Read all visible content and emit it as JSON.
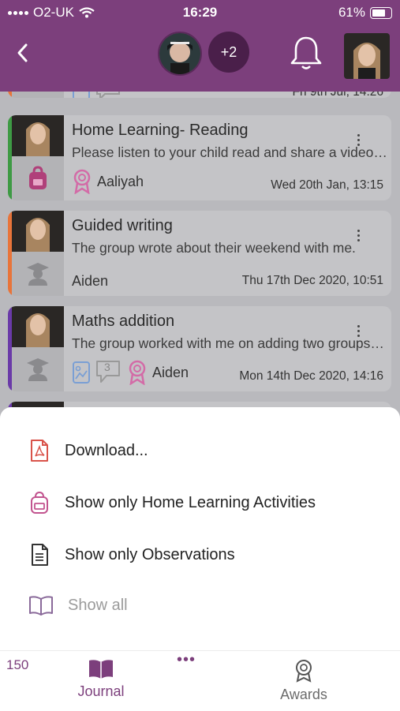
{
  "status_bar": {
    "carrier": "O2-UK",
    "time": "16:29",
    "battery": "61%"
  },
  "header": {
    "more_children": "+2"
  },
  "entries": [
    {
      "title": "",
      "description": "",
      "date": "Fri 9th Jul, 14:26",
      "bar_color": "#e8743a"
    },
    {
      "title": "Home Learning- Reading",
      "description": "Please listen to your child read and share a video of them reading.",
      "award_name": "Aaliyah",
      "date": "Wed 20th Jan, 13:15",
      "bar_color": "#3e9a44"
    },
    {
      "title": "Guided writing",
      "description": "The group wrote about their weekend with me.",
      "child_name": "Aiden",
      "date": "Thu 17th Dec 2020, 10:51",
      "bar_color": "#e8743a"
    },
    {
      "title": "Maths addition",
      "description": "The group worked with me on adding two groups of objects together.",
      "comment_count": "3",
      "award_name": "Aiden",
      "date": "Mon 14th Dec 2020, 14:16",
      "bar_color": "#6a3aa8"
    }
  ],
  "menu": {
    "items": [
      {
        "label": "Download..."
      },
      {
        "label": "Show only Home Learning Activities"
      },
      {
        "label": "Show only Observations"
      },
      {
        "label": "Show all"
      }
    ]
  },
  "tabbar": {
    "count": "150",
    "journal_label": "Journal",
    "more_label": "•••",
    "awards_label": "Awards"
  },
  "colors": {
    "brand": "#7c3f7c",
    "sheet": "#ffffff"
  }
}
